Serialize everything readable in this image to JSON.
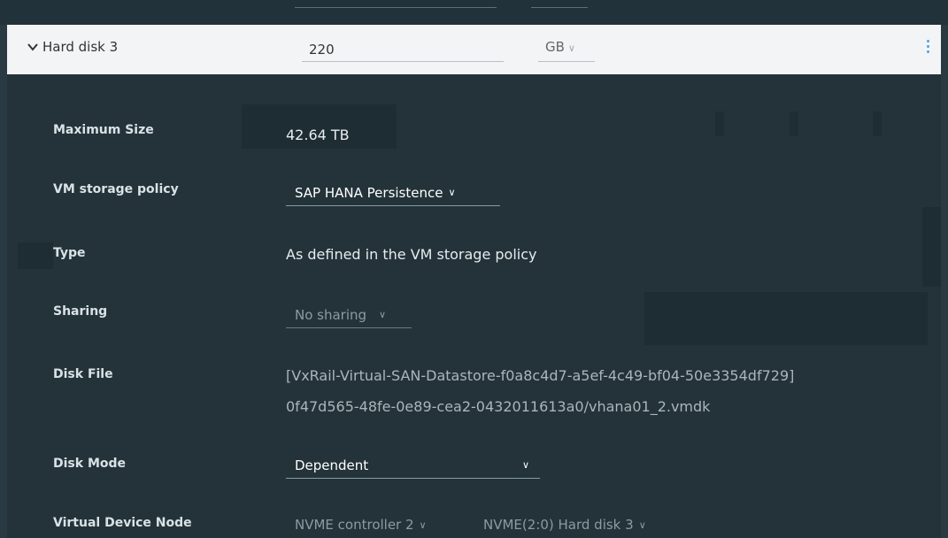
{
  "disk": {
    "title": "Hard disk 3",
    "size_value": "220",
    "size_unit": "GB"
  },
  "fields": {
    "max_size_label": "Maximum Size",
    "max_size_value": "42.64 TB",
    "policy_label": "VM storage policy",
    "policy_value": "SAP HANA Persistence",
    "type_label": "Type",
    "type_value": "As defined in the VM storage policy",
    "sharing_label": "Sharing",
    "sharing_value": "No sharing",
    "disk_file_label": "Disk File",
    "disk_file_line1": "[VxRail-Virtual-SAN-Datastore-f0a8c4d7-a5ef-4c49-bf04-50e3354df729]",
    "disk_file_line2": "0f47d565-48fe-0e89-cea2-0432011613a0/vhana01_2.vmdk",
    "disk_mode_label": "Disk Mode",
    "disk_mode_value": "Dependent",
    "vdn_label": "Virtual Device Node",
    "vdn_controller": "NVME controller 2",
    "vdn_node": "NVME(2:0) Hard disk 3"
  },
  "icons": {
    "toggle": "chevron-down-icon",
    "select_caret": "chevron-down-icon",
    "menu": "more-vertical-icon"
  },
  "colors": {
    "accent": "#4aa3df",
    "panel_bg": "#233339",
    "header_bg": "#f2f4f5"
  }
}
